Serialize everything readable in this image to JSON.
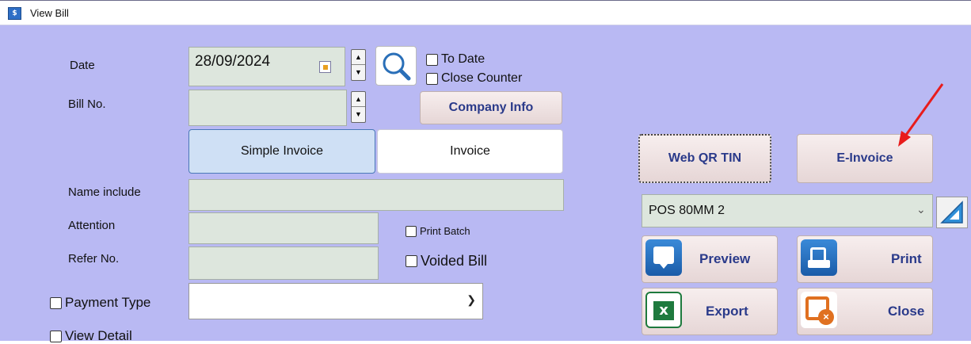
{
  "window": {
    "title": "View Bill",
    "icon": "bill-icon"
  },
  "date": {
    "label": "Date",
    "value": "28/09/2024",
    "to_date_label": "To Date",
    "close_counter_label": "Close Counter"
  },
  "bill_no": {
    "label": "Bill No.",
    "value": ""
  },
  "company_info_label": "Company Info",
  "tabs": {
    "simple_invoice": "Simple Invoice",
    "invoice": "Invoice"
  },
  "name_include": {
    "label": "Name include",
    "value": ""
  },
  "attention": {
    "label": "Attention",
    "value": ""
  },
  "refer_no": {
    "label": "Refer No.",
    "value": ""
  },
  "print_batch_label": "Print Batch",
  "voided_bill_label": "Voided Bill",
  "payment_type": {
    "label": "Payment Type",
    "value": ""
  },
  "view_detail_label": "View Detail",
  "buttons": {
    "web_qr_tin": "Web QR TIN",
    "e_invoice": "E-Invoice",
    "preview": "Preview",
    "print": "Print",
    "export": "Export",
    "close": "Close"
  },
  "printer": {
    "selected": "POS 80MM 2"
  },
  "colors": {
    "background": "#b9b9f3",
    "field": "#dde6dd",
    "button_text": "#2a3a8a",
    "arrow": "#e81c1c"
  }
}
